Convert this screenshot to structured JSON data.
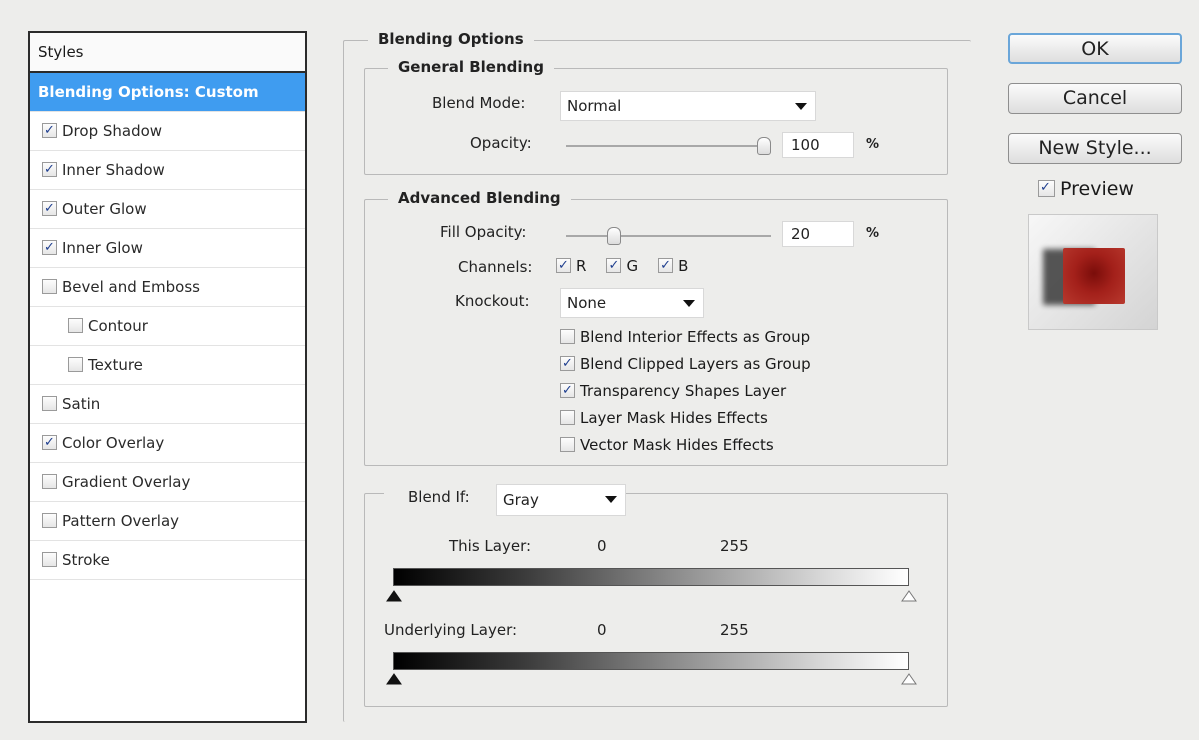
{
  "styles_panel": {
    "header": "Styles",
    "items": [
      {
        "label": "Blending Options: Custom",
        "checkbox": null,
        "selected": true,
        "indent": false
      },
      {
        "label": "Drop Shadow",
        "checkbox": true,
        "selected": false,
        "indent": false
      },
      {
        "label": "Inner Shadow",
        "checkbox": true,
        "selected": false,
        "indent": false
      },
      {
        "label": "Outer Glow",
        "checkbox": true,
        "selected": false,
        "indent": false
      },
      {
        "label": "Inner Glow",
        "checkbox": true,
        "selected": false,
        "indent": false
      },
      {
        "label": "Bevel and Emboss",
        "checkbox": false,
        "selected": false,
        "indent": false
      },
      {
        "label": "Contour",
        "checkbox": false,
        "selected": false,
        "indent": true
      },
      {
        "label": "Texture",
        "checkbox": false,
        "selected": false,
        "indent": true
      },
      {
        "label": "Satin",
        "checkbox": false,
        "selected": false,
        "indent": false
      },
      {
        "label": "Color Overlay",
        "checkbox": true,
        "selected": false,
        "indent": false
      },
      {
        "label": "Gradient Overlay",
        "checkbox": false,
        "selected": false,
        "indent": false
      },
      {
        "label": "Pattern Overlay",
        "checkbox": false,
        "selected": false,
        "indent": false
      },
      {
        "label": "Stroke",
        "checkbox": false,
        "selected": false,
        "indent": false
      }
    ]
  },
  "blending_options": {
    "title": "Blending Options",
    "general": {
      "title": "General Blending",
      "blend_mode_label": "Blend Mode:",
      "blend_mode_value": "Normal",
      "opacity_label": "Opacity:",
      "opacity_value": "100",
      "opacity_unit": "%",
      "opacity_level": 1.0
    },
    "advanced": {
      "title": "Advanced Blending",
      "fill_opacity_label": "Fill Opacity:",
      "fill_opacity_value": "20",
      "fill_opacity_unit": "%",
      "fill_opacity_level": 0.2,
      "channels_label": "Channels:",
      "channels": [
        {
          "label": "R",
          "checked": true
        },
        {
          "label": "G",
          "checked": true
        },
        {
          "label": "B",
          "checked": true
        }
      ],
      "knockout_label": "Knockout:",
      "knockout_value": "None",
      "options": [
        {
          "label": "Blend Interior Effects as Group",
          "checked": false
        },
        {
          "label": "Blend Clipped Layers as Group",
          "checked": true
        },
        {
          "label": "Transparency Shapes Layer",
          "checked": true
        },
        {
          "label": "Layer Mask Hides Effects",
          "checked": false
        },
        {
          "label": "Vector Mask Hides Effects",
          "checked": false
        }
      ]
    },
    "blend_if": {
      "label": "Blend If:",
      "value": "Gray",
      "this_layer_label": "This Layer:",
      "this_layer_min": "0",
      "this_layer_max": "255",
      "underlying_label": "Underlying Layer:",
      "underlying_min": "0",
      "underlying_max": "255"
    }
  },
  "buttons": {
    "ok": "OK",
    "cancel": "Cancel",
    "new_style": "New Style...",
    "preview_label": "Preview",
    "preview_checked": true
  },
  "colors": {
    "selection": "#3f9cf0",
    "preview_swatch": "#a3201a"
  }
}
